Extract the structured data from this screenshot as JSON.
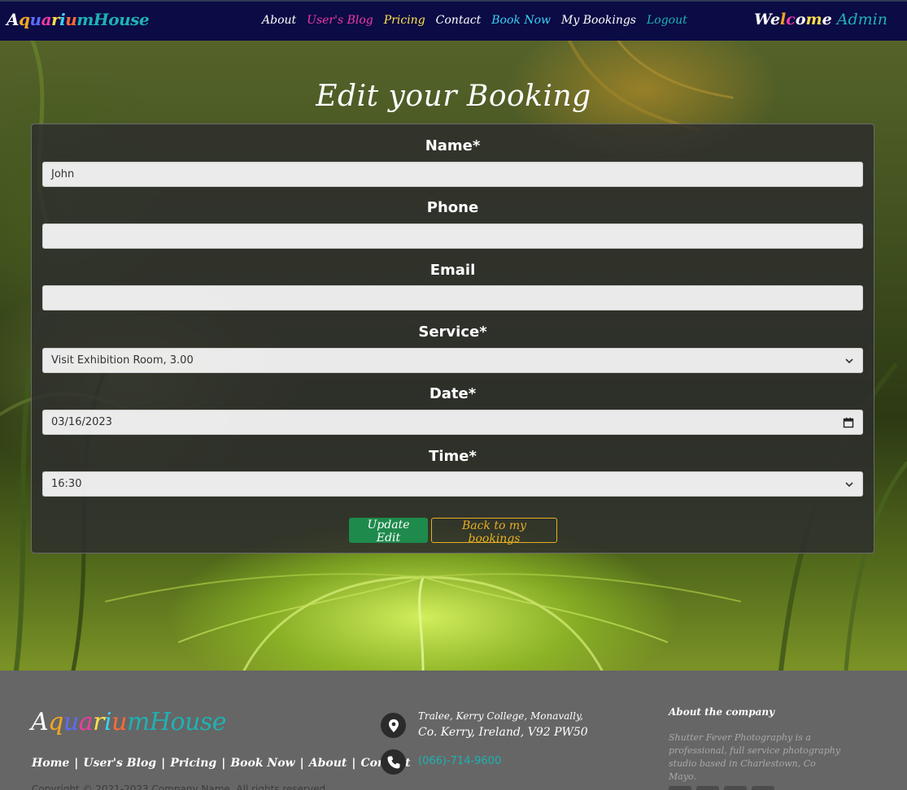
{
  "nav": {
    "brand": "AquariumHouse",
    "links": [
      "About",
      "User's Blog",
      "Pricing",
      "Contact",
      "Book Now",
      "My Bookings",
      "Logout"
    ],
    "welcome": "Welcome",
    "username": "Admin"
  },
  "page": {
    "title": "Edit your Booking"
  },
  "form": {
    "name_label": "Name*",
    "name_value": "John",
    "phone_label": "Phone",
    "phone_value": "",
    "email_label": "Email",
    "email_value": "",
    "service_label": "Service*",
    "service_value": "Visit Exhibition Room, 3.00",
    "date_label": "Date*",
    "date_value": "03/16/2023",
    "time_label": "Time*",
    "time_value": "16:30",
    "update_button": "Update Edit",
    "back_button": "Back to my bookings"
  },
  "footer": {
    "brand": "AquariumHouse",
    "links": [
      "Home",
      "User's Blog",
      "Pricing",
      "Book Now",
      "About",
      "Contact"
    ],
    "copyright": "Copyright © 2021-2023 Company Name. All rights reserved.",
    "address_line1": "Tralee, Kerry College, Monavally,",
    "address_line2": "Co. Kerry, Ireland, V92 PW50",
    "phone": "(066)-714-9600",
    "about_title": "About the company",
    "about_text": "Shutter Fever Photography is a professional, full service photography studio based in Charlestown, Co Mayo."
  },
  "colors": {
    "navbar_bg": "#0b0b45",
    "accent_teal": "#1eb2b2",
    "update_green": "#1e8a4c",
    "back_gold": "#e8b020",
    "footer_bg": "#666666",
    "brand_letters": [
      "#ffffff",
      "#f5a623",
      "#5b6cff",
      "#f23aa4",
      "#ffe14a",
      "#3ad1f5",
      "#ff6b35",
      "#1eb2b2"
    ]
  },
  "icons": {
    "location": "location-pin-icon",
    "phone": "phone-icon",
    "dropdown": "chevron-down-icon",
    "calendar": "calendar-icon"
  }
}
